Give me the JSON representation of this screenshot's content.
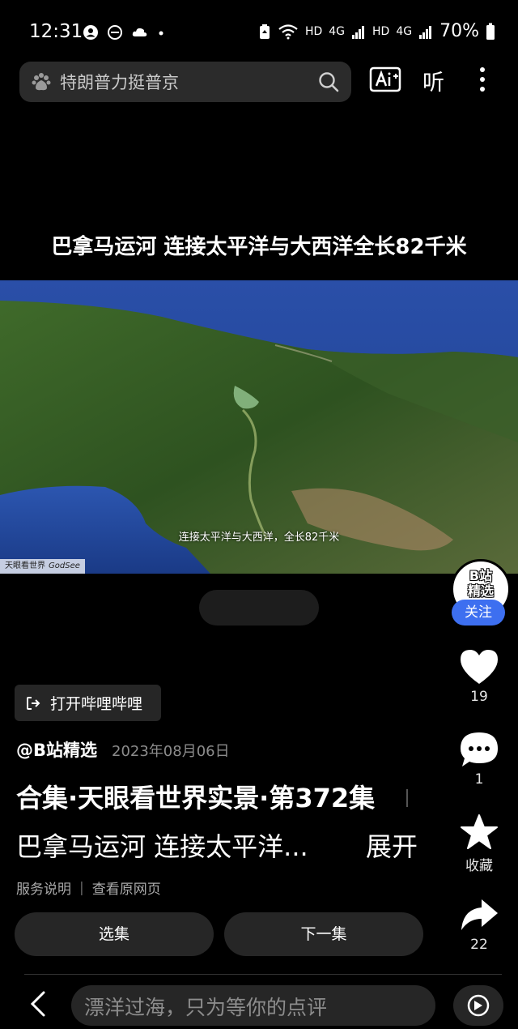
{
  "status_bar": {
    "time": "12:31",
    "network_label_1": "HD",
    "network_label_2": "4G",
    "network_label_3": "HD",
    "network_label_4": "4G",
    "battery": "70%"
  },
  "search": {
    "query": "特朗普力挺普京"
  },
  "top_actions": {
    "listen_label": "听"
  },
  "video": {
    "headline": "巴拿马运河 连接太平洋与大西洋全长82千米",
    "subtitle": "连接太平洋与大西洋，全长82千米",
    "watermark_cn": "天眼看世界",
    "watermark_en": "GodSee"
  },
  "channel": {
    "avatar_line1": "B站",
    "avatar_line2": "精选",
    "follow_label": "关注"
  },
  "rail": {
    "likes": "19",
    "comments": "1",
    "favorite_label": "收藏",
    "shares": "22"
  },
  "content": {
    "open_app_label": "打开哔哩哔哩",
    "author": "@B站精选",
    "date": "2023年08月06日",
    "title": "合集·天眼看世界实景·第372集",
    "description": "巴拿马运河 连接太平洋...",
    "expand_label": "展开",
    "service_label": "服务说明",
    "original_label": "查看原网页"
  },
  "buttons": {
    "select_label": "选集",
    "next_label": "下一集"
  },
  "bottom": {
    "comment_placeholder": "漂洋过海，只为等你的点评"
  },
  "colors": {
    "accent": "#3d6ff0",
    "background": "#000000",
    "surface": "#262626"
  }
}
